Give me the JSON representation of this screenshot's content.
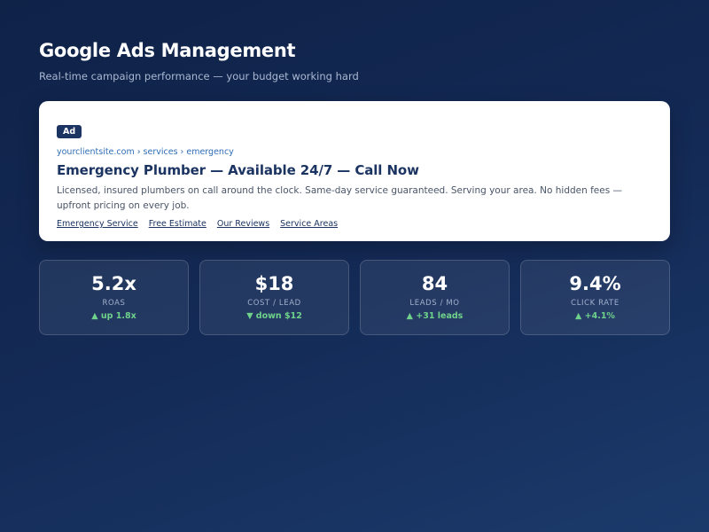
{
  "header": {
    "title": "Google Ads Management",
    "subtitle": "Real-time campaign performance — your budget working hard"
  },
  "ad": {
    "badge": "Ad",
    "url": "yourclientsite.com › services › emergency",
    "headline": "Emergency Plumber — Available 24/7 — Call Now",
    "description": "Licensed, insured plumbers on call around the clock. Same-day service guaranteed. Serving your area. No hidden fees — upfront pricing on every job.",
    "sitelinks": [
      "Emergency Service",
      "Free Estimate",
      "Our Reviews",
      "Service Areas"
    ]
  },
  "stats": [
    {
      "value": "5.2x",
      "label": "ROAS",
      "delta": "▲ up 1.8x"
    },
    {
      "value": "$18",
      "label": "COST / LEAD",
      "delta": "▼ down $12"
    },
    {
      "value": "84",
      "label": "LEADS / MO",
      "delta": "▲ +31 leads"
    },
    {
      "value": "9.4%",
      "label": "CLICK RATE",
      "delta": "▲ +4.1%"
    }
  ],
  "colors": {
    "background": "#142b57",
    "accent_navy": "#1b3461",
    "link_blue": "#2e6db5",
    "positive_green": "#6fd28b"
  }
}
